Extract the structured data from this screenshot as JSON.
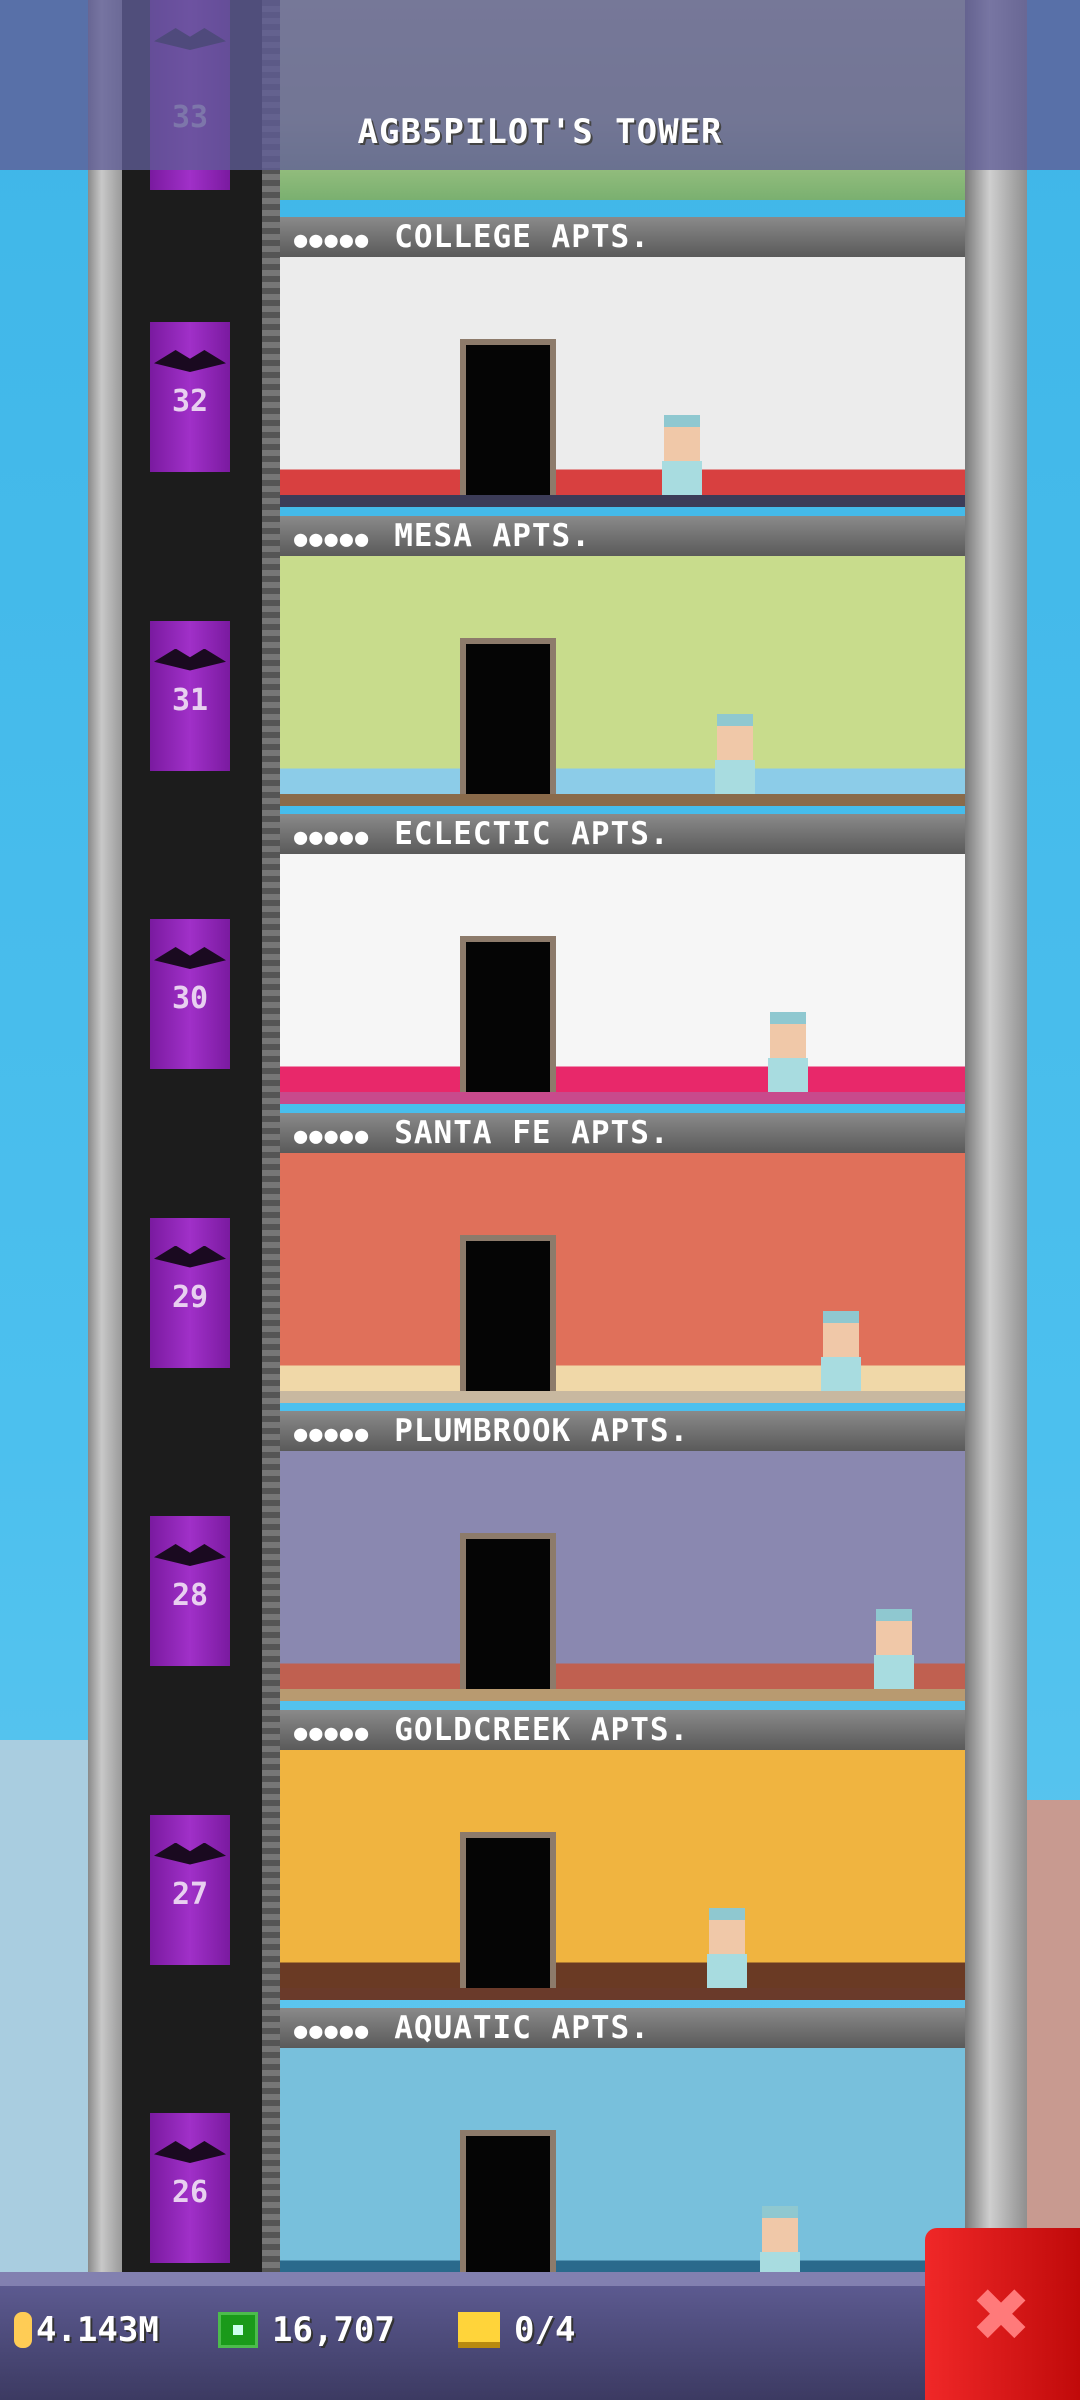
{
  "tower_title": "AGB5PILOT'S TOWER",
  "top_floor_number": "33",
  "floors": [
    {
      "number": "32",
      "name": "COLLEGE APTS.",
      "residents_icon": "●●●●●",
      "wall": "#ececec",
      "floor": "#3c3c58",
      "accent": "#d84040"
    },
    {
      "number": "31",
      "name": "MESA APTS.",
      "residents_icon": "●●●●●",
      "wall": "#c8dc8c",
      "floor": "#8a6a4a",
      "accent": "#8ccce8"
    },
    {
      "number": "30",
      "name": "ECLECTIC APTS.",
      "residents_icon": "●●●●●",
      "wall": "#f6f6f6",
      "floor": "#c84a8c",
      "accent": "#e8286a"
    },
    {
      "number": "29",
      "name": "SANTA FE APTS.",
      "residents_icon": "●●●●●",
      "wall": "#e0705a",
      "floor": "#c8b8a0",
      "accent": "#f0d8a8"
    },
    {
      "number": "28",
      "name": "PLUMBROOK APTS.",
      "residents_icon": "●●●●●",
      "wall": "#8a88b0",
      "floor": "#b89a70",
      "accent": "#c06050"
    },
    {
      "number": "27",
      "name": "GOLDCREEK APTS.",
      "residents_icon": "●●●●●",
      "wall": "#f0b440",
      "floor": "#6a3a2a",
      "accent": "#6a3a24"
    },
    {
      "number": "26",
      "name": "AQUATIC APTS.",
      "residents_icon": "●●●●●",
      "wall": "#78c0dc",
      "floor": "#3a6a8a",
      "accent": "#2a6a8c"
    }
  ],
  "stats": {
    "coins": "4.143M",
    "bux": "16,707",
    "tickets": "0/4"
  },
  "close_label": "✖",
  "icons": {
    "coin": "coin-icon",
    "bux": "tower-bux-icon",
    "ticket": "golden-ticket-icon",
    "close": "close-icon"
  }
}
